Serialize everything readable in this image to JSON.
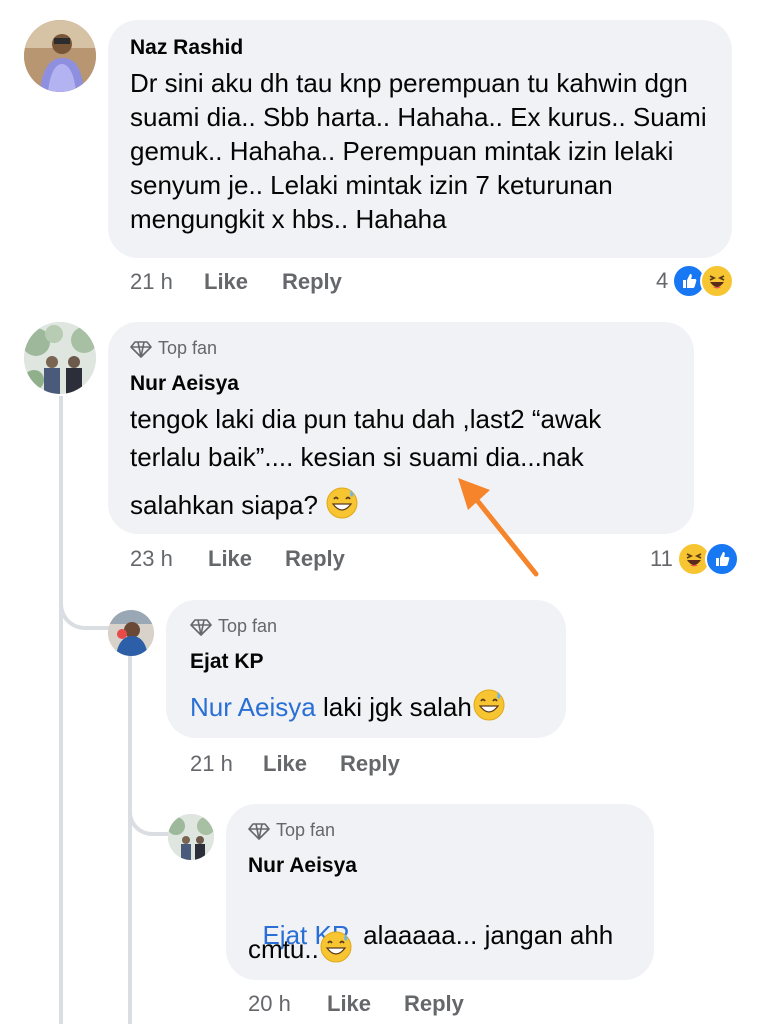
{
  "comments": [
    {
      "author": "Naz Rashid",
      "badge": "",
      "text": "Dr sini aku dh tau knp perempuan tu kahwin dgn suami dia.. Sbb harta.. Hahaha.. Ex kurus.. Suami gemuk.. Hahaha.. Perempuan mintak izin lelaki senyum je.. Lelaki mintak izin 7 keturunan mengungkit x hbs.. Hahaha",
      "time": "21 h",
      "like": "Like",
      "reply": "Reply",
      "reaction_count": "4",
      "reactions": [
        "like-icon",
        "haha-icon"
      ]
    },
    {
      "author": "Nur Aeisya",
      "badge": "Top fan",
      "text_line1": "tengok laki dia pun tahu dah ,last2 “awak",
      "text_line2": "terlalu baik”.... kesian si suami dia...nak",
      "text_line3": "salahkan siapa?",
      "time": "23 h",
      "like": "Like",
      "reply": "Reply",
      "reaction_count": "11",
      "reactions": [
        "haha-icon",
        "like-icon"
      ]
    },
    {
      "author": "Ejat KP",
      "badge": "Top fan",
      "mention": "Nur Aeisya",
      "text": " laki jgk salah",
      "time": "21 h",
      "like": "Like",
      "reply": "Reply"
    },
    {
      "author": "Nur Aeisya",
      "badge": "Top fan",
      "mention": "Ejat KP",
      "text_line1": "  alaaaaa... jangan ahh",
      "text_line2": "cmtu..",
      "time": "20 h",
      "like": "Like",
      "reply": "Reply"
    }
  ],
  "colors": {
    "bubble": "#f0f2f5",
    "link": "#2a6fd6",
    "meta": "#65676b",
    "arrow": "#f5842a"
  }
}
